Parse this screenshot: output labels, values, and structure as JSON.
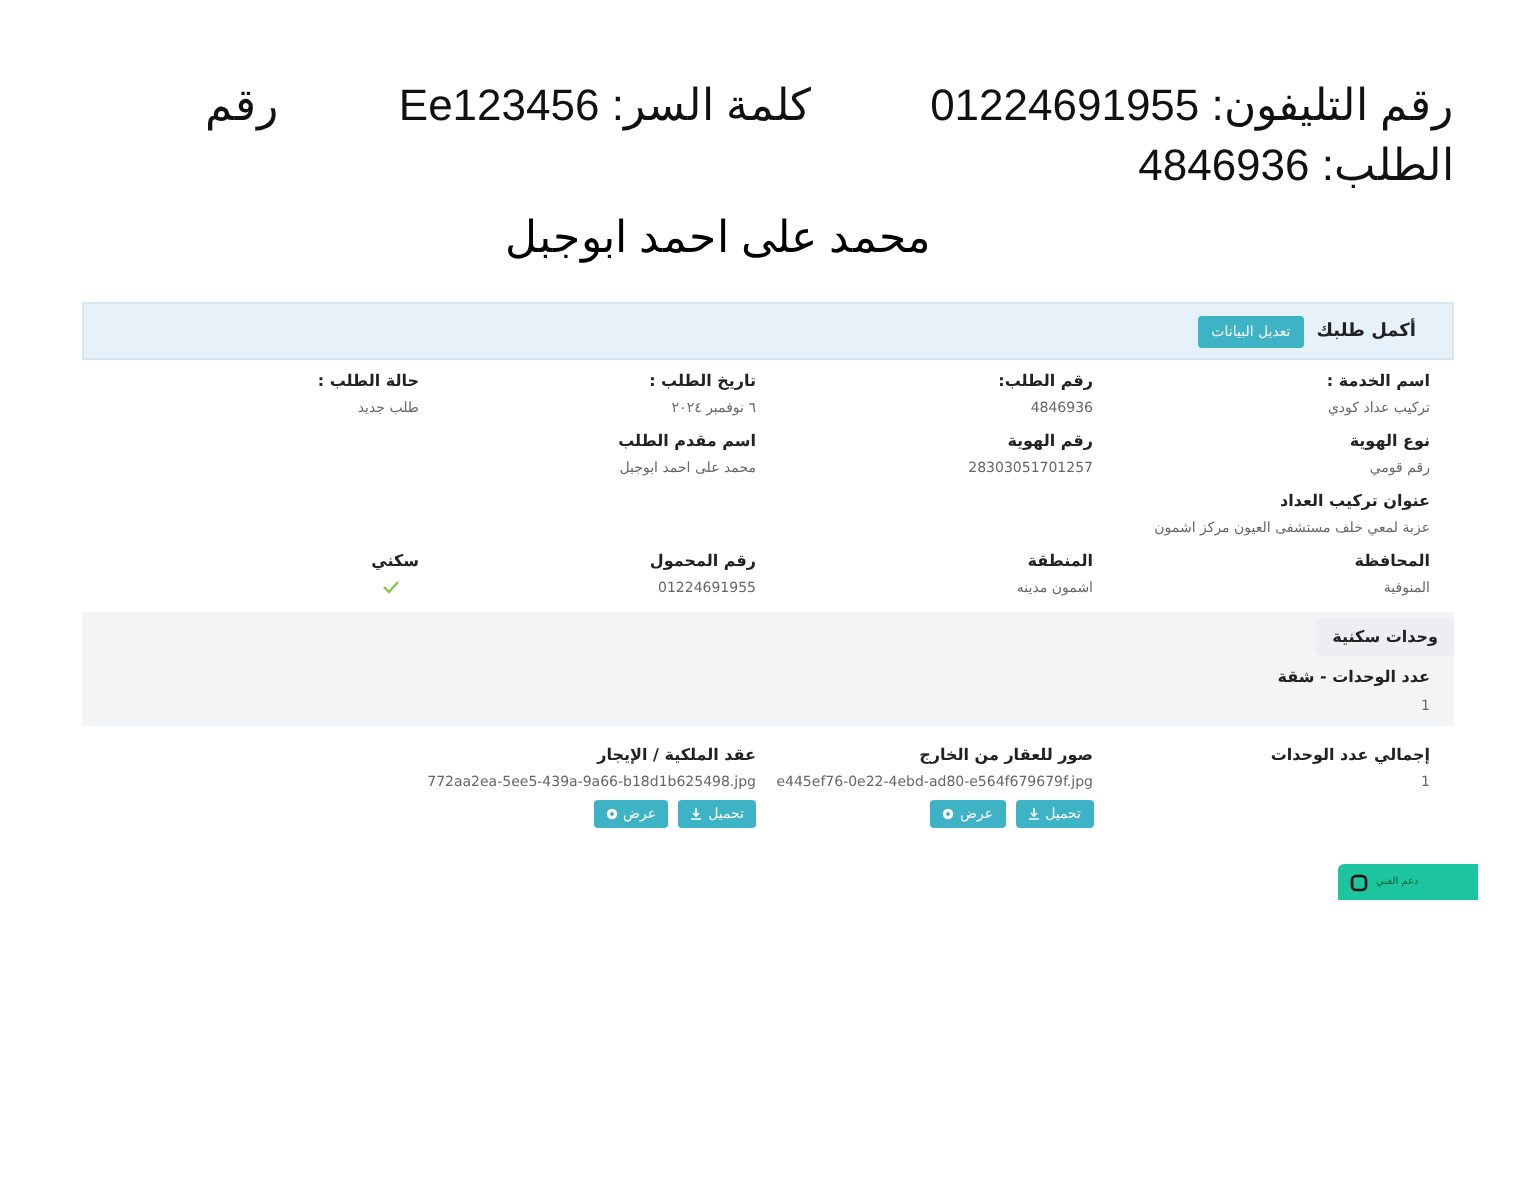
{
  "header": {
    "phone": "رقم التليفون: 01224691955",
    "password": "كلمة السر: Ee123456",
    "order": "رقم الطلب: 4846936",
    "name": "محمد على احمد ابوجبل"
  },
  "panel": {
    "title": "أكمل طلبك",
    "edit_button": "تعديل البيانات"
  },
  "fields": [
    {
      "label": "اسم الخدمة :",
      "value": "تركيب عداد كودي",
      "kind": "text"
    },
    {
      "label": "رقم الطلب:",
      "value": "4846936",
      "kind": "text"
    },
    {
      "label": "تاريخ الطلب :",
      "value": "٦ نوفمبر ٢٠٢٤",
      "kind": "text"
    },
    {
      "label": "حالة الطلب :",
      "value": "طلب جديد",
      "kind": "text"
    },
    {
      "label": "نوع الهوية",
      "value": "رقم قومي",
      "kind": "text"
    },
    {
      "label": "رقم الهوية",
      "value": "28303051701257",
      "kind": "text"
    },
    {
      "label": "اسم مقدم الطلب",
      "value": "محمد على احمد ابوجبل",
      "kind": "text"
    },
    {
      "label": "عنوان تركيب العداد",
      "value": "عزبة لمعي خلف مستشفى العيون مركز اشمون",
      "kind": "wide"
    },
    {
      "label": "المحافظة",
      "value": "المنوفية",
      "kind": "text"
    },
    {
      "label": "المنطقة",
      "value": "اشمون مدينه",
      "kind": "text"
    },
    {
      "label": "رقم المحمول",
      "value": "01224691955",
      "kind": "text"
    },
    {
      "label": "سكني",
      "kind": "check"
    }
  ],
  "units": {
    "tab": "وحدات سكنية",
    "label": "عدد الوحدات - شقة",
    "value": "1"
  },
  "total": {
    "label": "إجمالي عدد الوحدات",
    "value": "1"
  },
  "files": [
    {
      "label": "صور للعقار من الخارج",
      "file": "e445ef76-0e22-4ebd-ad80-e564f679679f.jpg",
      "download": "تحميل",
      "view": "عرض"
    },
    {
      "label": "عقد الملكية / الإيجار",
      "file": "772aa2ea-5ee5-439a-9a66-b18d1b625498.jpg",
      "download": "تحميل",
      "view": "عرض"
    }
  ],
  "support_button": "دعم الفني"
}
